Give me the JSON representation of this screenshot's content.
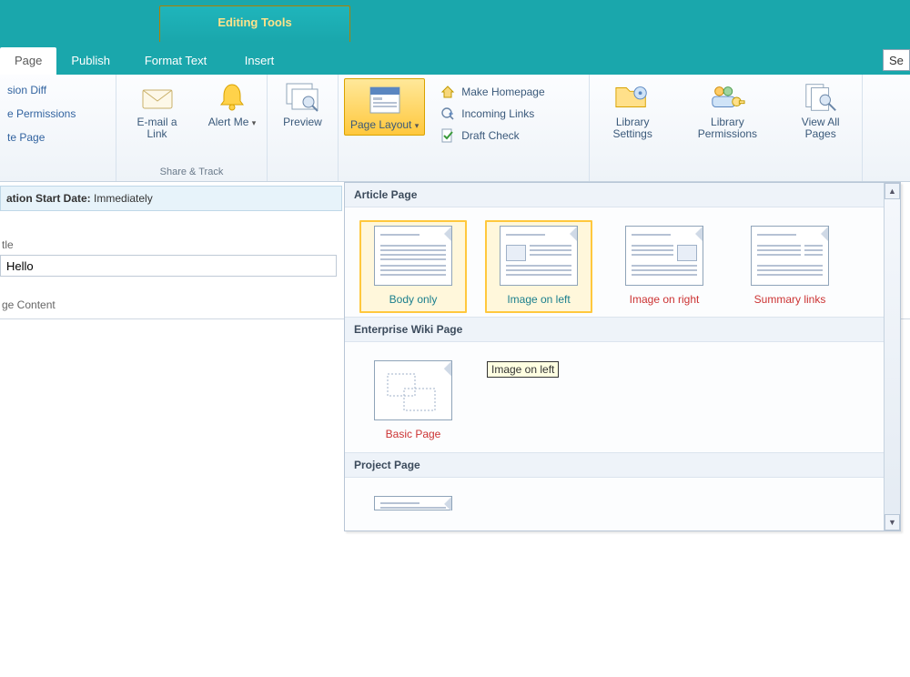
{
  "banner": {
    "context_group_label": "Editing Tools",
    "tabs": {
      "page": "Page",
      "publish": "Publish",
      "format_text": "Format Text",
      "insert": "Insert"
    },
    "search_placeholder": "Se"
  },
  "ribbon": {
    "left_options": {
      "version_diff": "sion Diff",
      "permissions": "e Permissions",
      "delete_page": "te Page"
    },
    "email": "E-mail a Link",
    "alert": "Alert Me",
    "share_group": "Share & Track",
    "preview": "Preview",
    "page_layout": "Page Layout",
    "make_homepage": "Make Homepage",
    "incoming_links": "Incoming Links",
    "draft_check": "Draft Check",
    "library_settings": "Library Settings",
    "library_permissions": "Library Permissions",
    "view_all_pages": "View All Pages"
  },
  "page": {
    "status_label": "ation Start Date:",
    "status_value": "Immediately",
    "title_field_label": "tle",
    "title_value": "Hello",
    "page_content_label": "ge Content"
  },
  "gallery": {
    "tooltip": "Image on left",
    "categories": [
      {
        "name": "Article Page",
        "items": [
          {
            "label": "Body only",
            "selected": true,
            "kind": "body"
          },
          {
            "label": "Image on left",
            "selected": true,
            "kind": "img-left"
          },
          {
            "label": "Image on right",
            "selected": false,
            "kind": "img-right"
          },
          {
            "label": "Summary links",
            "selected": false,
            "kind": "summary"
          }
        ]
      },
      {
        "name": "Enterprise Wiki Page",
        "items": [
          {
            "label": "Basic Page",
            "selected": false,
            "kind": "basic"
          }
        ]
      },
      {
        "name": "Project Page",
        "items": []
      }
    ]
  }
}
